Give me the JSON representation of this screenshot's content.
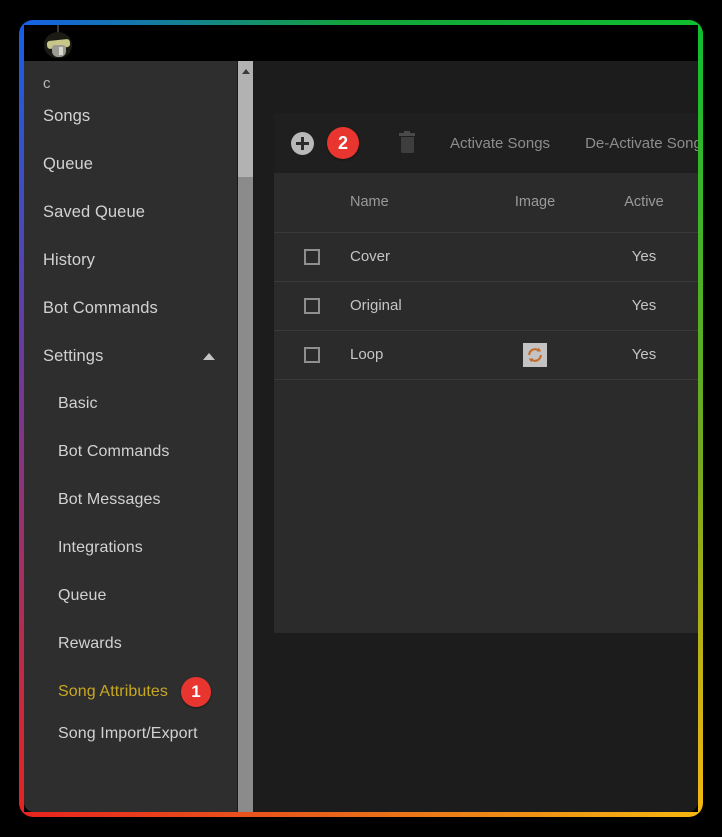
{
  "window": {
    "avatar_icon": "helmet-avatar-icon",
    "frame_gradient": {
      "top": [
        "#1560e8",
        "#0fbe2e"
      ],
      "right": [
        "#0fbe2e",
        "#f5b810"
      ],
      "bottom": [
        "#e8231f",
        "#f5b810"
      ],
      "left": [
        "#1560e8",
        "#e8231f"
      ]
    }
  },
  "sidebar": {
    "truncated_label": "c",
    "items": [
      {
        "label": "Songs",
        "level": "top",
        "active": false,
        "badge": null,
        "icon": null
      },
      {
        "label": "Queue",
        "level": "top",
        "active": false,
        "badge": null,
        "icon": null
      },
      {
        "label": "Saved Queue",
        "level": "top",
        "active": false,
        "badge": null,
        "icon": null
      },
      {
        "label": "History",
        "level": "top",
        "active": false,
        "badge": null,
        "icon": null
      },
      {
        "label": "Bot Commands",
        "level": "top",
        "active": false,
        "badge": null,
        "icon": null
      },
      {
        "label": "Settings",
        "level": "top",
        "active": false,
        "badge": null,
        "icon": "chevron-up-icon"
      },
      {
        "label": "Basic",
        "level": "sub",
        "active": false,
        "badge": null,
        "icon": null
      },
      {
        "label": "Bot Commands",
        "level": "sub",
        "active": false,
        "badge": null,
        "icon": null
      },
      {
        "label": "Bot Messages",
        "level": "sub",
        "active": false,
        "badge": null,
        "icon": null
      },
      {
        "label": "Integrations",
        "level": "sub",
        "active": false,
        "badge": null,
        "icon": null
      },
      {
        "label": "Queue",
        "level": "sub",
        "active": false,
        "badge": null,
        "icon": null
      },
      {
        "label": "Rewards",
        "level": "sub",
        "active": false,
        "badge": null,
        "icon": null
      },
      {
        "label": "Song Attributes",
        "level": "sub",
        "active": true,
        "badge": "1",
        "icon": null
      },
      {
        "label": "Song Import/Export",
        "level": "sub",
        "active": false,
        "badge": null,
        "icon": null
      }
    ],
    "active_color": "#c8a822",
    "scrollbar": {
      "arrow_icon": "scroll-up-arrow-icon"
    }
  },
  "toolbar": {
    "add_icon": "plus-circle-icon",
    "add_badge": "2",
    "delete_icon": "trash-icon",
    "activate_label": "Activate Songs",
    "deactivate_label": "De-Activate Songs"
  },
  "table": {
    "columns": [
      "",
      "Name",
      "Image",
      "Active"
    ],
    "rows": [
      {
        "checked": false,
        "name": "Cover",
        "image_icon": null,
        "active": "Yes"
      },
      {
        "checked": false,
        "name": "Original",
        "image_icon": null,
        "active": "Yes"
      },
      {
        "checked": false,
        "name": "Loop",
        "image_icon": "loop-icon",
        "active": "Yes"
      }
    ]
  },
  "colors": {
    "badge_red": "#e8352f",
    "loop_orange": "#c46a28",
    "sidebar_bg": "#2e2e2e",
    "panel_bg": "#2b2b2b"
  }
}
